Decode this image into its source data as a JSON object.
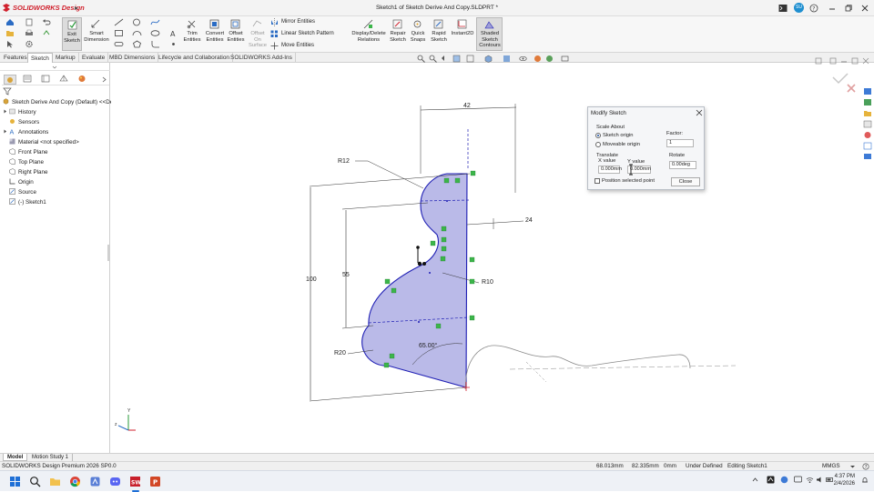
{
  "app": {
    "brand": "SOLIDWORKS Design",
    "window_title": "Sketch1 of Sketch Derive And Copy.SLDPRT *",
    "user_initials": "SU"
  },
  "ribbon": {
    "exit_sketch": "Exit Sketch",
    "smart_dimension": "Smart Dimension",
    "trim_entities": "Trim Entities",
    "convert_entities": "Convert Entities",
    "offset_entities": "Offset Entities",
    "offset_on_surface": "Offset On Surface",
    "mirror_entities": "Mirror Entities",
    "linear_sketch_pattern": "Linear Sketch Pattern",
    "move_entities": "Move Entities",
    "display_delete_relations": "Display/Delete Relations",
    "repair_sketch": "Repair Sketch",
    "quick_snaps": "Quick Snaps",
    "rapid_sketch": "Rapid Sketch",
    "instant2d": "Instant2D",
    "shaded_sketch_contours": "Shaded Sketch Contours"
  },
  "tabs": [
    "Features",
    "Sketch",
    "Markup",
    "Evaluate",
    "MBD Dimensions",
    "Lifecycle and Collaboration",
    "SOLIDWORKS Add-Ins"
  ],
  "active_tab": "Sketch",
  "tree": {
    "root": "Sketch Derive And Copy (Default) <<Def",
    "items": [
      "History",
      "Sensors",
      "Annotations",
      "Material <not specified>",
      "Front Plane",
      "Top Plane",
      "Right Plane",
      "Origin",
      "Source",
      "(-) Sketch1"
    ]
  },
  "dimensions": {
    "d42": "42",
    "r12": "R12",
    "d24": "24",
    "d55": "55",
    "d100": "100",
    "r10": "R10",
    "r20": "R20",
    "angle": "65.00°"
  },
  "dialog": {
    "title": "Modify Sketch",
    "scale_about": "Scale About",
    "sketch_origin": "Sketch origin",
    "moveable_origin": "Moveable origin",
    "factor_label": "Factor:",
    "factor_value": "1",
    "translate": "Translate",
    "x_value_label": "X value",
    "y_value_label": "Y value",
    "x_value": "0.000mm",
    "y_value": "0.000mm",
    "rotate_label": "Rotate",
    "rotate_value": "0.00deg",
    "position_selected_point": "Position selected point",
    "close": "Close"
  },
  "bottom_tabs": [
    "Model",
    "Motion Study 1"
  ],
  "status": {
    "product": "SOLIDWORKS Design Premium 2026 SP0.0",
    "x": "68.013mm",
    "y": "82.335mm",
    "z": "0mm",
    "state": "Under Defined",
    "editing": "Editing Sketch1",
    "units": "MMGS"
  },
  "taskbar": {
    "time": "4:37 PM",
    "date": "2/4/2026"
  },
  "colors": {
    "accent_red": "#d0202c",
    "sketch_fill": "#b3b3e6",
    "sketch_line": "#1f1fb4",
    "relation_green": "#3cb54a"
  }
}
